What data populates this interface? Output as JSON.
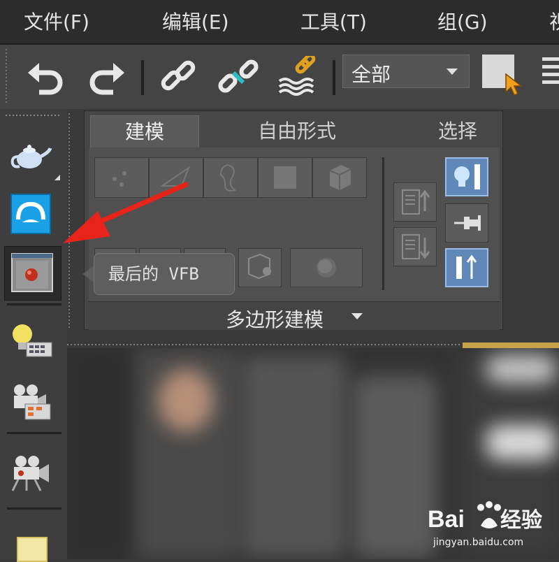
{
  "menubar": {
    "items": [
      "文件(F)",
      "编辑(E)",
      "工具(T)",
      "组(G)",
      "视"
    ]
  },
  "toolbar": {
    "buttons": [
      "undo-icon",
      "redo-icon",
      "link-icon",
      "unlink-icon",
      "bind-space-warp-icon"
    ],
    "selection_filter": "全部",
    "select_object_icon": "select-object-icon",
    "list_icon": "select-by-name-icon"
  },
  "leftbar": {
    "icons": [
      "teapot-icon",
      "autodesk-360-icon",
      "frame-buffer-icon",
      "light-list-icon",
      "camera-render-icon",
      "camera-icon",
      "sun-icon"
    ]
  },
  "ribbon": {
    "tabs": [
      {
        "label": "建模",
        "active": true
      },
      {
        "label": "自由形式",
        "active": false
      },
      {
        "label": "选择",
        "active": false
      }
    ],
    "group_label": "多边形建模",
    "colors": {
      "active_toggle": "#5f87b8",
      "highlight_border": "#9bbde6"
    }
  },
  "tooltip": {
    "text": "最后的 VFB"
  },
  "watermark": {
    "brand": "Baidu经验",
    "url": "jingyan.baidu.com"
  },
  "annotation": {
    "arrow_color": "#e8231a"
  }
}
